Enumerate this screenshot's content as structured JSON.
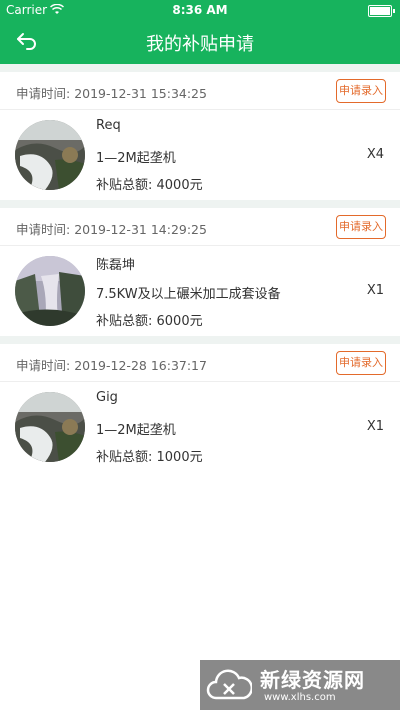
{
  "status_bar": {
    "carrier": "Carrier",
    "time": "8:36 AM"
  },
  "nav": {
    "title": "我的补贴申请",
    "back_icon": "back-arrow-icon"
  },
  "labels": {
    "apply_time": "申请时间:",
    "apply_button": "申请录入"
  },
  "records": [
    {
      "apply_time": "2019-12-31 15:34:25",
      "name": "Req",
      "product": "1—2M起垄机",
      "quantity": "X4",
      "total": "补贴总额:  4000元"
    },
    {
      "apply_time": "2019-12-31 14:29:25",
      "name": "陈磊坤",
      "product": "7.5KW及以上碾米加工成套设备",
      "quantity": "X1",
      "total": "补贴总额:  6000元"
    },
    {
      "apply_time": "2019-12-28 16:37:17",
      "name": "Gig",
      "product": "1—2M起垄机",
      "quantity": "X1",
      "total": "补贴总额:  1000元"
    }
  ],
  "watermark": {
    "title": "新绿资源网",
    "url": "www.xlhs.com"
  },
  "colors": {
    "brand_green": "#17b35d",
    "apply_orange": "#e36a2b",
    "divider": "#eef3f1"
  }
}
